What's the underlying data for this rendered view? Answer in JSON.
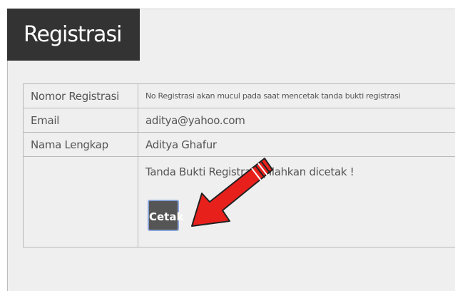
{
  "header": {
    "title": "Registrasi"
  },
  "form": {
    "rows": [
      {
        "label": "Nomor Registrasi",
        "value": "No Registrasi akan mucul pada saat mencetak tanda bukti registrasi"
      },
      {
        "label": "Email",
        "value": "aditya@yahoo.com"
      },
      {
        "label": "Nama Lengkap",
        "value": "Aditya Ghafur"
      }
    ],
    "notice": "Tanda Bukti Registrasi Silahkan dicetak !",
    "print_button_label": "Cetak"
  },
  "annotation": {
    "arrow_icon": "red-arrow-icon",
    "arrow_color": "#e8201c"
  },
  "colors": {
    "header_bg": "#333333",
    "panel_bg": "#efefef",
    "button_bg": "#555555",
    "button_border": "#8aa3d8"
  }
}
